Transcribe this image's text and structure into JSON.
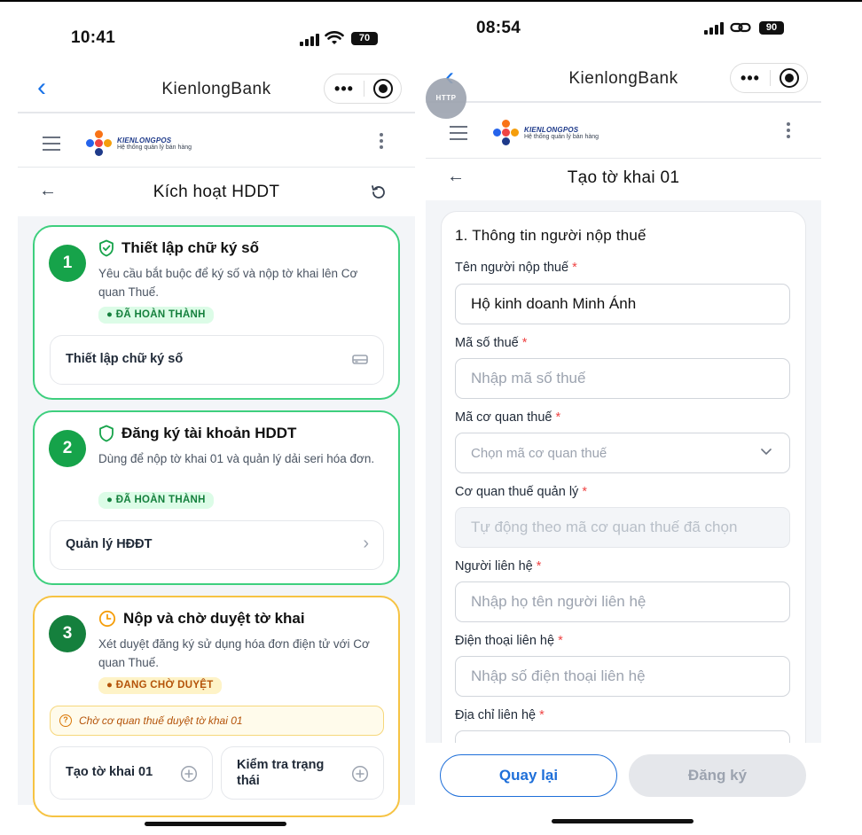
{
  "left": {
    "status": {
      "time": "10:41",
      "battery": "70"
    },
    "app_title": "KienlongBank",
    "logo": {
      "name": "KIENLONGPOS",
      "tagline": "Hệ thống quản lý bán hàng"
    },
    "page_title": "Kích hoạt HDDT",
    "steps": [
      {
        "number": "1",
        "title": "Thiết lập chữ ký số",
        "description": "Yêu cầu bắt buộc để ký số và nộp tờ khai lên Cơ quan Thuế.",
        "status": "ĐÃ HOÀN THÀNH",
        "action": "Thiết lập chữ ký số"
      },
      {
        "number": "2",
        "title": "Đăng ký tài khoản HDDT",
        "description": "Dùng để nộp tờ khai 01 và quản lý dải seri hóa đơn.",
        "status": "ĐÃ HOÀN THÀNH",
        "action": "Quản lý HĐĐT"
      },
      {
        "number": "3",
        "title": "Nộp và chờ duyệt tờ khai",
        "description": "Xét duyệt đăng ký sử dụng hóa đơn điện tử với Cơ quan Thuế.",
        "status": "ĐANG CHỜ DUYỆT",
        "notice": "Chờ cơ quan thuế duyệt tờ khai 01",
        "actions": [
          "Tạo tờ khai 01",
          "Kiểm tra trạng thái"
        ]
      }
    ]
  },
  "right": {
    "status": {
      "time": "08:54",
      "battery": "90"
    },
    "http_badge": "HTTP",
    "app_title": "KienlongBank",
    "logo": {
      "name": "KIENLONGPOS",
      "tagline": "Hệ thống quản lý bán hàng"
    },
    "page_title": "Tạo tờ khai 01",
    "section_title": "1. Thông tin người nộp thuế",
    "required_mark": "*",
    "fields": [
      {
        "label": "Tên người nộp thuế",
        "value": "Hộ kinh doanh Minh Ánh"
      },
      {
        "label": "Mã số thuế",
        "placeholder": "Nhập mã số thuế"
      },
      {
        "label": "Mã cơ quan thuế",
        "placeholder": "Chọn mã cơ quan thuế"
      },
      {
        "label": "Cơ quan thuế quản lý",
        "placeholder": "Tự động theo mã cơ quan thuế đã chọn"
      },
      {
        "label": "Người liên hệ",
        "placeholder": "Nhập họ tên người liên hệ"
      },
      {
        "label": "Điện thoại liên hệ",
        "placeholder": "Nhập số điện thoại liên hệ"
      },
      {
        "label": "Địa chỉ liên hệ"
      }
    ],
    "buttons": {
      "back": "Quay lại",
      "submit": "Đăng ký"
    }
  },
  "colors": {
    "accent": "#1e6fd9",
    "success": "#16a34a",
    "warning": "#f6c343",
    "danger": "#ef4444"
  }
}
